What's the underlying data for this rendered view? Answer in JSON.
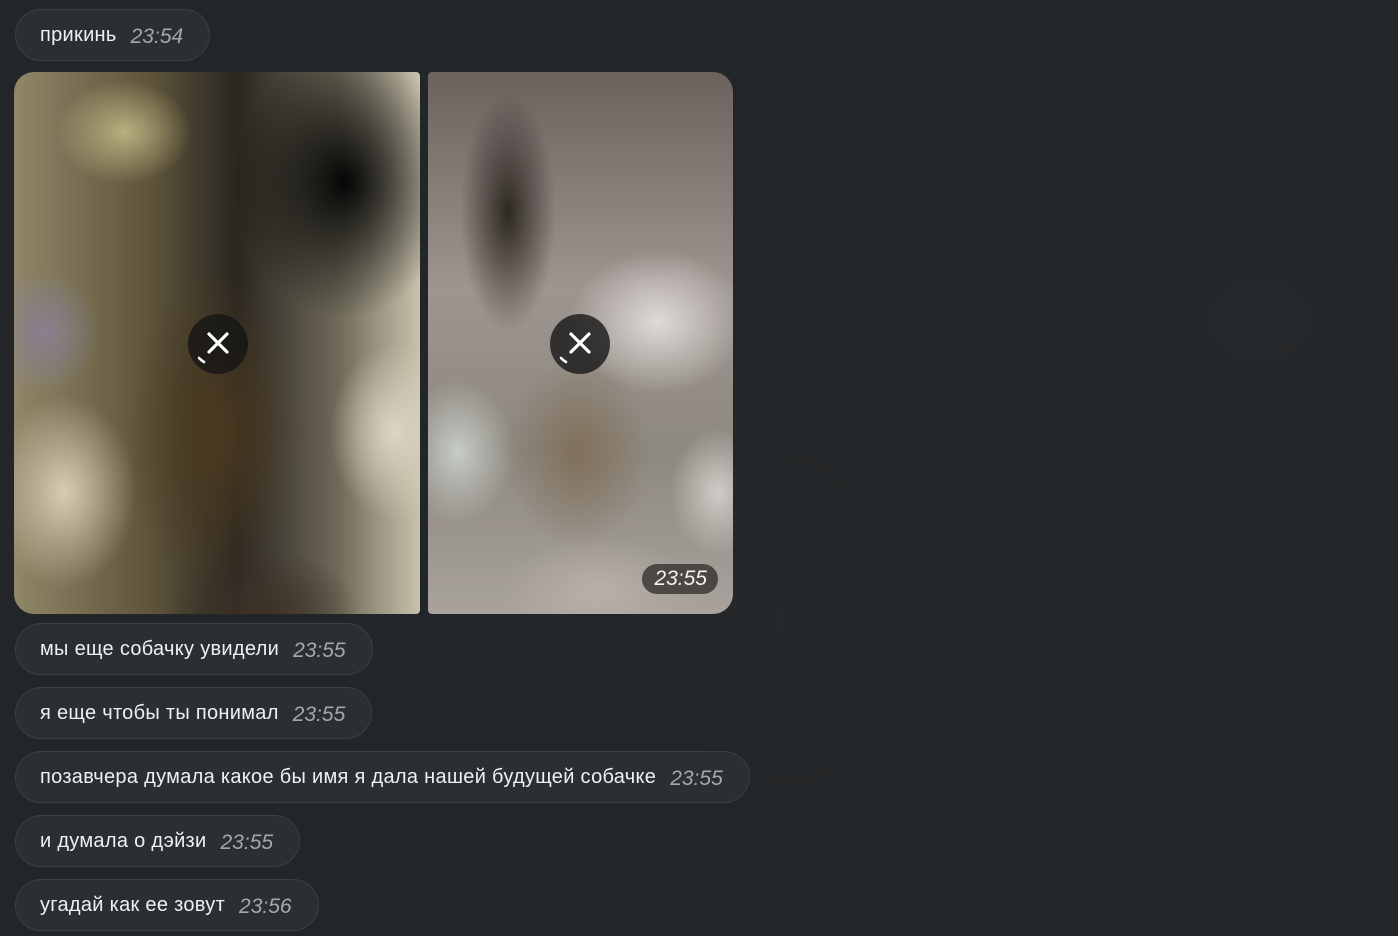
{
  "messages_before": [
    {
      "text": "прикинь",
      "time": "23:54"
    }
  ],
  "media_album": {
    "time": "23:55",
    "items": [
      {
        "cancel_icon": "close-icon"
      },
      {
        "cancel_icon": "close-icon"
      }
    ]
  },
  "messages_after": [
    {
      "text": "мы еще собачку увидели",
      "time": "23:55"
    },
    {
      "text": "я еще чтобы ты понимал",
      "time": "23:55"
    },
    {
      "text": "позавчера думала какое бы имя я дала нашей будущей собачке",
      "time": "23:55"
    },
    {
      "text": "и думала о дэйзи",
      "time": "23:55"
    },
    {
      "text": "угадай как ее зовут",
      "time": "23:56"
    }
  ],
  "colors": {
    "background": "#232628",
    "bubble": "#2c2f32",
    "bubble_border": "#3c3f43",
    "text": "#eef0f2",
    "time": "#a2a8b2"
  }
}
